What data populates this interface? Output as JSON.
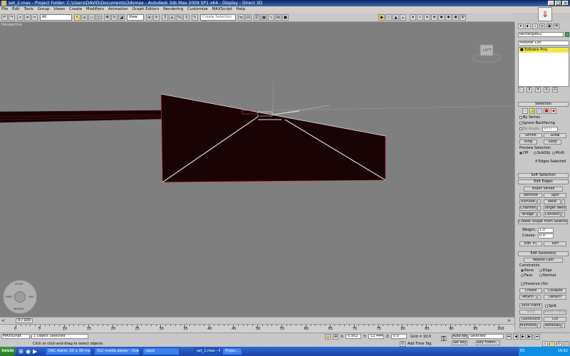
{
  "window": {
    "title": "set_2.max   - Project Folder: C:\\Users\\DAVID\\Documents\\3dsmax     -     Autodesk 3ds Max  2009 SP1  x64        -  Display : Direct 3D"
  },
  "menu": [
    "File",
    "Edit",
    "Tools",
    "Group",
    "Views",
    "Create",
    "Modifiers",
    "Animation",
    "Graph Editors",
    "Rendering",
    "Customize",
    "MAXScript",
    "Help"
  ],
  "toolbar": {
    "filter_select": "All",
    "coord_select": "View",
    "selection_set_placeholder": "Create Selection Se"
  },
  "viewport": {
    "label": "Perspective",
    "viewcube_label": "LEFT",
    "nav_labels": [
      "ZOOM",
      "ORBIT",
      "PAN",
      "REWIND"
    ],
    "colors": {
      "background": "#7f7f7f",
      "shape": "#1a0305",
      "edge": "#d8d8d8"
    }
  },
  "command_panel": {
    "object_name": "Rectangle02",
    "modifier_list": "Modifier List",
    "stack_item": "Editable Poly",
    "selection": {
      "title": "Selection",
      "by_vertex": "By Vertex",
      "ignore_backfacing": "Ignore Backfacing",
      "by_angle": "By Angle:",
      "angle_value": "45.0",
      "shrink": "Shrink",
      "grow": "Grow",
      "ring": "Ring",
      "loop": "Loop",
      "preview_selection": "Preview Selection",
      "preview_options": [
        "Off",
        "SubObj",
        "Multi"
      ],
      "status": "4 Edges Selected"
    },
    "soft_selection": "Soft Selection",
    "edit_edges": {
      "title": "Edit Edges",
      "insert_vertex": "Insert Vertex",
      "remove": "Remove",
      "split": "Split",
      "extrude": "Extrude",
      "weld": "Weld",
      "chamfer": "Chamfer",
      "target_weld": "Target Weld",
      "bridge": "Bridge",
      "connect": "Connect",
      "create_shape": "Create Shape From Selection",
      "weight_label": "Weight:",
      "weight_value": "1.0",
      "crease_label": "Crease:",
      "crease_value": "0.0",
      "edit_tri": "Edit Tri.",
      "turn": "Turn"
    },
    "edit_geometry": {
      "title": "Edit Geometry",
      "repeat_last": "Repeat Last",
      "constraints": "Constraints",
      "constraint_options": [
        "None",
        "Edge",
        "Face",
        "Normal"
      ],
      "preserve_uvs": "Preserve UVs",
      "create": "Create",
      "collapse": "Collapse",
      "attach": "Attach",
      "detach": "Detach",
      "slice_plane": "Slice Plane",
      "split": "Split",
      "slice": "Slice",
      "reset_plane": "Reset Plane",
      "quickslice": "QuickSlice",
      "cut": "Cut",
      "msmooth": "MSmooth",
      "tessellate": "Tessellate"
    }
  },
  "timeline": {
    "frame_display": "0 / 100",
    "ruler_labels": [
      "0",
      "5",
      "10",
      "15",
      "20",
      "25",
      "30",
      "35",
      "40",
      "45",
      "50",
      "55",
      "60",
      "65",
      "70",
      "75",
      "80",
      "85",
      "90",
      "95",
      "100"
    ]
  },
  "status": {
    "maxscript_label": "MAXScript.",
    "objects_selected": "1 Object Selected",
    "prompt": "Click or click-and-drag to select objects",
    "x_label": "X:",
    "x_value": "0.952",
    "y_label": "Y:",
    "y_value": "12.444",
    "z_label": "Z:",
    "z_value": "0.0",
    "grid": "Grid = 10,0",
    "add_time_tag": "Add Time Tag",
    "auto_key": "Auto Key",
    "auto_key_select": "Selected",
    "set_key": "Set Key",
    "key_filters": "Key Filters..."
  },
  "taskbar": {
    "start": "Inicio",
    "tasks": [
      "DAC Aiello: 2D a 3D modi...",
      "VLC media player - Over...",
      "rapid",
      "set_2.max   - Project...",
      "Projec..."
    ],
    "language": "ES",
    "clock": "19:52"
  }
}
